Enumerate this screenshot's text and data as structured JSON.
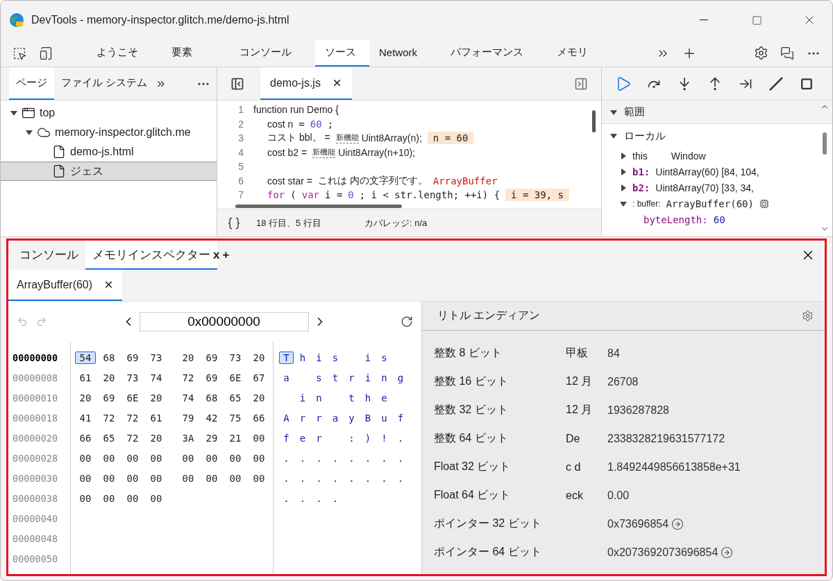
{
  "window": {
    "title": "DevTools - memory-inspector.glitch.me/demo-js.html"
  },
  "main_tabs": [
    {
      "label": "ようこそ",
      "selected": false
    },
    {
      "label": "要素",
      "selected": false
    },
    {
      "label": "コンソール",
      "selected": false
    },
    {
      "label": "ソース",
      "selected": true
    },
    {
      "label": "Network",
      "selected": false
    },
    {
      "label": "パフォーマンス",
      "selected": false
    },
    {
      "label": "メモリ",
      "selected": false
    }
  ],
  "navigator": {
    "tabs": [
      {
        "label": "ページ",
        "selected": true
      },
      {
        "label": "ファイル システム",
        "selected": false
      }
    ],
    "tree": [
      {
        "label": "top",
        "kind": "frame",
        "expanded": true,
        "selected": false,
        "children": [
          {
            "label": "memory-inspector.glitch.me",
            "kind": "domain",
            "expanded": true,
            "selected": false,
            "children": [
              {
                "label": "demo-js.html",
                "kind": "file",
                "selected": false
              },
              {
                "label": "ジェス",
                "kind": "file",
                "selected": true
              }
            ]
          }
        ]
      }
    ]
  },
  "editor": {
    "tab": "demo-js.js",
    "lines": [
      {
        "number": "1",
        "segments": [
          {
            "kind": "plain",
            "text": "function run Demo {"
          }
        ]
      },
      {
        "number": "2",
        "segments": [
          {
            "kind": "plain",
            "text": "cost n"
          },
          {
            "kind": "mono",
            "text": "= "
          },
          {
            "kind": "number",
            "text": "60"
          },
          {
            "kind": "mono",
            "text": ";"
          }
        ]
      },
      {
        "number": "3",
        "segments": [
          {
            "kind": "plain",
            "text": "コスト bbl。 ="
          },
          {
            "kind": "badge",
            "text": "新機能"
          },
          {
            "kind": "plain",
            "text": "Uint8Array(n);"
          },
          {
            "kind": "inline",
            "text": "n = 60"
          }
        ]
      },
      {
        "number": "4",
        "segments": [
          {
            "kind": "plain",
            "text": "cost b2 ="
          },
          {
            "kind": "badge",
            "text": "新機能"
          },
          {
            "kind": "plain",
            "text": "Uint8Array(n+10);"
          }
        ]
      },
      {
        "number": "5"
      },
      {
        "number": "6",
        "segments": [
          {
            "kind": "plain",
            "text": "cost star ="
          },
          {
            "kind": "plain",
            "text": "これは 内の文字列です。"
          },
          {
            "kind": "type",
            "text": "ArrayBuffer"
          }
        ]
      },
      {
        "number": "7",
        "segments": [
          {
            "kind": "keyword",
            "text": "for"
          },
          {
            "kind": "mono",
            "text": " ("
          },
          {
            "kind": "keyword",
            "text": "var"
          },
          {
            "kind": "mono",
            "text": " i = "
          },
          {
            "kind": "number",
            "text": "0"
          },
          {
            "kind": "mono",
            "text": "; i < str.length; ++i) {"
          },
          {
            "kind": "inline",
            "text": "i = 39, s"
          }
        ]
      }
    ],
    "status": {
      "position": "18 行目、5 行目",
      "coverage": "カバレッジ: n/a"
    }
  },
  "debugger": {
    "sections": [
      {
        "title": "範囲",
        "expanded": true
      },
      {
        "title": "ローカル",
        "expanded": true
      }
    ],
    "scope": [
      {
        "kind": "plain",
        "name": "this",
        "value": "Window",
        "expanded": false
      },
      {
        "kind": "prop",
        "name": "b1:",
        "value": "Uint8Array(60) [84, 104,",
        "expanded": false
      },
      {
        "kind": "prop",
        "name": "b2:",
        "value": "Uint8Array(70) [33, 34,",
        "expanded": false
      },
      {
        "kind": "buffer",
        "name": ": buffer:",
        "value": "ArrayBuffer(60)",
        "expanded": true,
        "children": [
          {
            "kind": "mono",
            "name": "byteLength:",
            "value": "60"
          }
        ]
      }
    ]
  },
  "drawer": {
    "tabs": [
      {
        "label": "コンソール",
        "selected": false
      },
      {
        "label": "メモリインスペクター",
        "selected": true
      }
    ],
    "close_mark": "x",
    "add_mark": "+",
    "buffer_tabs": [
      {
        "label": "ArrayBuffer(60)",
        "selected": true
      }
    ],
    "address": "0x00000000",
    "rows": [
      {
        "address": "00000000",
        "current": true,
        "bytes": [
          {
            "v": "54",
            "selected": true
          },
          {
            "v": "68",
            "selected": false
          },
          {
            "v": "69",
            "selected": false
          },
          {
            "v": "73",
            "selected": false
          },
          {
            "v": "20",
            "selected": false
          },
          {
            "v": "69",
            "selected": false
          },
          {
            "v": "73",
            "selected": false
          },
          {
            "v": "20",
            "selected": false
          }
        ],
        "chars": [
          {
            "kind": "char",
            "c": "T"
          },
          {
            "kind": "char",
            "c": "h"
          },
          {
            "kind": "char",
            "c": "i"
          },
          {
            "kind": "char",
            "c": "s"
          },
          {
            "kind": "blank"
          },
          {
            "kind": "char",
            "c": "i"
          },
          {
            "kind": "char",
            "c": "s"
          },
          {
            "kind": "blank"
          }
        ]
      },
      {
        "address": "00000008",
        "current": false,
        "bytes": [
          {
            "v": "61",
            "selected": false
          },
          {
            "v": "20",
            "selected": false
          },
          {
            "v": "73",
            "selected": false
          },
          {
            "v": "74",
            "selected": false
          },
          {
            "v": "72",
            "selected": false
          },
          {
            "v": "69",
            "selected": false
          },
          {
            "v": "6E",
            "selected": false
          },
          {
            "v": "67",
            "selected": false
          }
        ],
        "chars": [
          {
            "kind": "char",
            "c": "a"
          },
          {
            "kind": "blank"
          },
          {
            "kind": "char",
            "c": "s"
          },
          {
            "kind": "char",
            "c": "t"
          },
          {
            "kind": "char",
            "c": "r"
          },
          {
            "kind": "char",
            "c": "i"
          },
          {
            "kind": "char",
            "c": "n"
          },
          {
            "kind": "char",
            "c": "g"
          }
        ]
      },
      {
        "address": "00000010",
        "current": false,
        "bytes": [
          {
            "v": "20",
            "selected": false
          },
          {
            "v": "69",
            "selected": false
          },
          {
            "v": "6E",
            "selected": false
          },
          {
            "v": "20",
            "selected": false
          },
          {
            "v": "74",
            "selected": false
          },
          {
            "v": "68",
            "selected": false
          },
          {
            "v": "65",
            "selected": false
          },
          {
            "v": "20",
            "selected": false
          }
        ],
        "chars": [
          {
            "kind": "blank"
          },
          {
            "kind": "char",
            "c": "i"
          },
          {
            "kind": "char",
            "c": "n"
          },
          {
            "kind": "blank"
          },
          {
            "kind": "char",
            "c": "t"
          },
          {
            "kind": "char",
            "c": "h"
          },
          {
            "kind": "char",
            "c": "e"
          },
          {
            "kind": "blank"
          }
        ]
      },
      {
        "address": "00000018",
        "current": false,
        "bytes": [
          {
            "v": "41",
            "selected": false
          },
          {
            "v": "72",
            "selected": false
          },
          {
            "v": "72",
            "selected": false
          },
          {
            "v": "61",
            "selected": false
          },
          {
            "v": "79",
            "selected": false
          },
          {
            "v": "42",
            "selected": false
          },
          {
            "v": "75",
            "selected": false
          },
          {
            "v": "66",
            "selected": false
          }
        ],
        "chars": [
          {
            "kind": "char",
            "c": "A"
          },
          {
            "kind": "char",
            "c": "r"
          },
          {
            "kind": "char",
            "c": "r"
          },
          {
            "kind": "char",
            "c": "a"
          },
          {
            "kind": "char",
            "c": "y"
          },
          {
            "kind": "char",
            "c": "B"
          },
          {
            "kind": "char",
            "c": "u"
          },
          {
            "kind": "char",
            "c": "f"
          }
        ]
      },
      {
        "address": "00000020",
        "current": false,
        "bytes": [
          {
            "v": "66",
            "selected": false
          },
          {
            "v": "65",
            "selected": false
          },
          {
            "v": "72",
            "selected": false
          },
          {
            "v": "20",
            "selected": false
          },
          {
            "v": "3A",
            "selected": false
          },
          {
            "v": "29",
            "selected": false
          },
          {
            "v": "21",
            "selected": false
          },
          {
            "v": "00",
            "selected": false
          }
        ],
        "chars": [
          {
            "kind": "char",
            "c": "f"
          },
          {
            "kind": "char",
            "c": "e"
          },
          {
            "kind": "char",
            "c": "r"
          },
          {
            "kind": "blank"
          },
          {
            "kind": "char",
            "c": ":"
          },
          {
            "kind": "char",
            "c": ")"
          },
          {
            "kind": "char",
            "c": "!"
          },
          {
            "kind": "char",
            "c": "."
          }
        ]
      },
      {
        "address": "00000028",
        "current": false,
        "bytes": [
          {
            "v": "00",
            "selected": false
          },
          {
            "v": "00",
            "selected": false
          },
          {
            "v": "00",
            "selected": false
          },
          {
            "v": "00",
            "selected": false
          },
          {
            "v": "00",
            "selected": false
          },
          {
            "v": "00",
            "selected": false
          },
          {
            "v": "00",
            "selected": false
          },
          {
            "v": "00",
            "selected": false
          }
        ],
        "chars": [
          {
            "kind": "char",
            "c": "."
          },
          {
            "kind": "char",
            "c": "."
          },
          {
            "kind": "char",
            "c": "."
          },
          {
            "kind": "char",
            "c": "."
          },
          {
            "kind": "char",
            "c": "."
          },
          {
            "kind": "char",
            "c": "."
          },
          {
            "kind": "char",
            "c": "."
          },
          {
            "kind": "char",
            "c": "."
          }
        ]
      },
      {
        "address": "00000030",
        "current": false,
        "bytes": [
          {
            "v": "00",
            "selected": false
          },
          {
            "v": "00",
            "selected": false
          },
          {
            "v": "00",
            "selected": false
          },
          {
            "v": "00",
            "selected": false
          },
          {
            "v": "00",
            "selected": false
          },
          {
            "v": "00",
            "selected": false
          },
          {
            "v": "00",
            "selected": false
          },
          {
            "v": "00",
            "selected": false
          }
        ],
        "chars": [
          {
            "kind": "char",
            "c": "."
          },
          {
            "kind": "char",
            "c": "."
          },
          {
            "kind": "char",
            "c": "."
          },
          {
            "kind": "char",
            "c": "."
          },
          {
            "kind": "char",
            "c": "."
          },
          {
            "kind": "char",
            "c": "."
          },
          {
            "kind": "char",
            "c": "."
          },
          {
            "kind": "char",
            "c": "."
          }
        ]
      },
      {
        "address": "00000038",
        "current": false,
        "bytes": [
          {
            "v": "00",
            "selected": false
          },
          {
            "v": "00",
            "selected": false
          },
          {
            "v": "00",
            "selected": false
          },
          {
            "v": "00",
            "selected": false
          }
        ],
        "chars": [
          {
            "kind": "char",
            "c": "."
          },
          {
            "kind": "char",
            "c": "."
          },
          {
            "kind": "char",
            "c": "."
          },
          {
            "kind": "char",
            "c": "."
          }
        ]
      },
      {
        "address": "00000040",
        "current": false
      },
      {
        "address": "00000048",
        "current": false
      },
      {
        "address": "00000050",
        "current": false
      }
    ],
    "inspector": {
      "endianness": "リトル エンディアン",
      "values": [
        {
          "kind": "number",
          "label": "整数 8 ビット",
          "mode": "甲板",
          "value": "84"
        },
        {
          "kind": "number",
          "label": "整数 16 ビット",
          "mode": "12 月",
          "value": "26708"
        },
        {
          "kind": "number",
          "label": "整数 32 ビット",
          "mode": "12 月",
          "value": "1936287828"
        },
        {
          "kind": "number",
          "label": "整数 64 ビット",
          "mode": "De",
          "value": "2338328219631577172"
        },
        {
          "kind": "number",
          "label": "Float 32 ビット",
          "mode": "c d",
          "value": "1.8492449856613858e+31"
        },
        {
          "kind": "number",
          "label": "Float 64 ビット",
          "mode": "eck",
          "value": "0.00"
        },
        {
          "kind": "pointer",
          "label": "ポインター 32 ビット",
          "value": "0x73696854"
        },
        {
          "kind": "pointer",
          "label": "ポインター 64 ビット",
          "value": "0x2073692073696854"
        }
      ]
    }
  }
}
